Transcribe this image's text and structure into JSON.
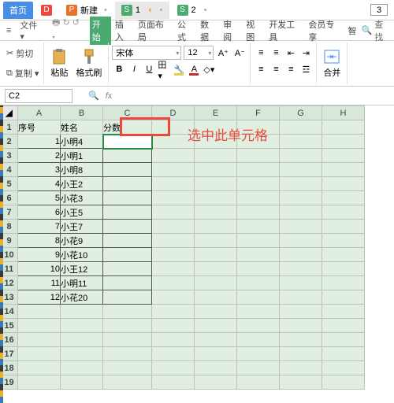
{
  "topTabs": {
    "home": "首页",
    "new": "新建",
    "s1": "1",
    "s2": "2",
    "badge": "3"
  },
  "fileBar": {
    "file": "文件",
    "arrows": "◂ ▸"
  },
  "menus": {
    "start": "开始",
    "insert": "插入",
    "pageLayout": "页面布局",
    "formula": "公式",
    "data": "数据",
    "review": "审阅",
    "view": "视图",
    "dev": "开发工具",
    "member": "会员专享",
    "more": "智",
    "search": "查找"
  },
  "ribbon": {
    "cut": "剪切",
    "copy": "复制",
    "paste": "粘贴",
    "formatPainter": "格式刷",
    "font": "宋体",
    "fontSize": "12",
    "merge": "合并"
  },
  "nameBox": "C2",
  "headers": [
    "A",
    "B",
    "C",
    "D",
    "E",
    "F",
    "G",
    "H"
  ],
  "rows": [
    {
      "n": 1,
      "a": "序号",
      "b": "姓名",
      "c": "分数"
    },
    {
      "n": 2,
      "a": "1",
      "b": "小明4",
      "c": ""
    },
    {
      "n": 3,
      "a": "2",
      "b": "小明1",
      "c": ""
    },
    {
      "n": 4,
      "a": "3",
      "b": "小明8",
      "c": ""
    },
    {
      "n": 5,
      "a": "4",
      "b": "小王2",
      "c": ""
    },
    {
      "n": 6,
      "a": "5",
      "b": "小花3",
      "c": ""
    },
    {
      "n": 7,
      "a": "6",
      "b": "小王5",
      "c": ""
    },
    {
      "n": 8,
      "a": "7",
      "b": "小王7",
      "c": ""
    },
    {
      "n": 9,
      "a": "8",
      "b": "小花9",
      "c": ""
    },
    {
      "n": 10,
      "a": "9",
      "b": "小花10",
      "c": ""
    },
    {
      "n": 11,
      "a": "10",
      "b": "小王12",
      "c": ""
    },
    {
      "n": 12,
      "a": "11",
      "b": "小明11",
      "c": ""
    },
    {
      "n": 13,
      "a": "12",
      "b": "小花20",
      "c": ""
    }
  ],
  "emptyRows": [
    14,
    15,
    16,
    17,
    18,
    19
  ],
  "annotation": "选中此单元格",
  "chart_data": {
    "type": "table",
    "columns": [
      "序号",
      "姓名",
      "分数"
    ],
    "rows": [
      [
        1,
        "小明4",
        null
      ],
      [
        2,
        "小明1",
        null
      ],
      [
        3,
        "小明8",
        null
      ],
      [
        4,
        "小王2",
        null
      ],
      [
        5,
        "小花3",
        null
      ],
      [
        6,
        "小王5",
        null
      ],
      [
        7,
        "小王7",
        null
      ],
      [
        8,
        "小花9",
        null
      ],
      [
        9,
        "小花10",
        null
      ],
      [
        10,
        "小王12",
        null
      ],
      [
        11,
        "小明11",
        null
      ],
      [
        12,
        "小花20",
        null
      ]
    ]
  }
}
